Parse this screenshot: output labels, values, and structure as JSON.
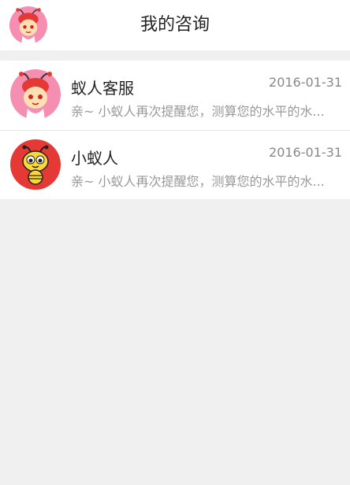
{
  "header": {
    "title": "我的咨询",
    "avatar_icon": "ant-girl-avatar-icon"
  },
  "conversations": [
    {
      "name": "蚁人客服",
      "date": "2016-01-31",
      "message": "亲~ 小蚁人再次提醒您，测算您的水平的水...",
      "avatar_icon": "ant-girl-avatar-icon",
      "avatar_bg": "#f48fb1"
    },
    {
      "name": "小蚁人",
      "date": "2016-01-31",
      "message": "亲~ 小蚁人再次提醒您，测算您的水平的水...",
      "avatar_icon": "ant-mascot-avatar-icon",
      "avatar_bg": "#e53935"
    }
  ],
  "colors": {
    "page_bg": "#f0f0f0",
    "card_bg": "#ffffff",
    "title_text": "#222222",
    "date_text": "#888888",
    "message_text": "#999999"
  }
}
